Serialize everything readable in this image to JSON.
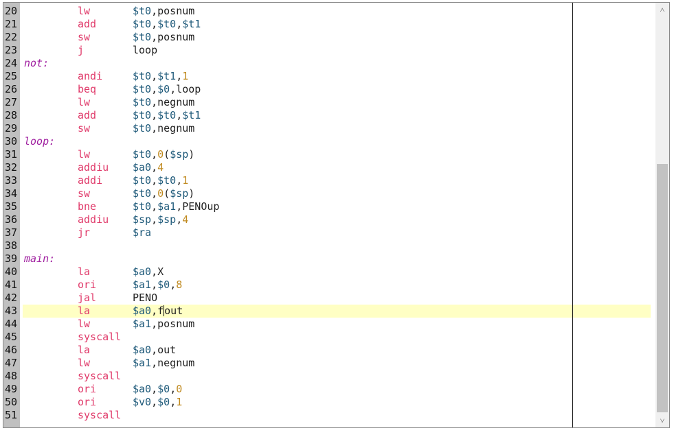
{
  "editor": {
    "current_line": 43,
    "cursor": {
      "line": 43,
      "column": 5
    },
    "scroll": {
      "thumb_start": 0.38,
      "thumb_end": 0.965
    },
    "icons": {
      "scroll_up": "chevron-up-icon",
      "scroll_down": "chevron-down-icon"
    },
    "colors": {
      "gutter": "#c0c0c0",
      "current_line": "#ffffc4",
      "label": "#a020a0",
      "instruction": "#e03a6a",
      "register": "#1f5a7a",
      "number": "#c08a20"
    },
    "lines": [
      {
        "n": "20",
        "label": "",
        "ins": "lw",
        "ops": [
          [
            "reg",
            "$t0"
          ],
          [
            "sym",
            ",posnum"
          ]
        ]
      },
      {
        "n": "21",
        "label": "",
        "ins": "add",
        "ops": [
          [
            "reg",
            "$t0"
          ],
          [
            "sym",
            ","
          ],
          [
            "reg",
            "$t0"
          ],
          [
            "sym",
            ","
          ],
          [
            "reg",
            "$t1"
          ]
        ]
      },
      {
        "n": "22",
        "label": "",
        "ins": "sw",
        "ops": [
          [
            "reg",
            "$t0"
          ],
          [
            "sym",
            ",posnum"
          ]
        ]
      },
      {
        "n": "23",
        "label": "",
        "ins": "j",
        "ops": [
          [
            "sym",
            "loop"
          ]
        ]
      },
      {
        "n": "24",
        "label": "not:",
        "ins": "",
        "ops": []
      },
      {
        "n": "25",
        "label": "",
        "ins": "andi",
        "ops": [
          [
            "reg",
            "$t0"
          ],
          [
            "sym",
            ","
          ],
          [
            "reg",
            "$t1"
          ],
          [
            "sym",
            ","
          ],
          [
            "num",
            "1"
          ]
        ]
      },
      {
        "n": "26",
        "label": "",
        "ins": "beq",
        "ops": [
          [
            "reg",
            "$t0"
          ],
          [
            "sym",
            ","
          ],
          [
            "reg",
            "$0"
          ],
          [
            "sym",
            ",loop"
          ]
        ]
      },
      {
        "n": "27",
        "label": "",
        "ins": "lw",
        "ops": [
          [
            "reg",
            "$t0"
          ],
          [
            "sym",
            ",negnum"
          ]
        ]
      },
      {
        "n": "28",
        "label": "",
        "ins": "add",
        "ops": [
          [
            "reg",
            "$t0"
          ],
          [
            "sym",
            ","
          ],
          [
            "reg",
            "$t0"
          ],
          [
            "sym",
            ","
          ],
          [
            "reg",
            "$t1"
          ]
        ]
      },
      {
        "n": "29",
        "label": "",
        "ins": "sw",
        "ops": [
          [
            "reg",
            "$t0"
          ],
          [
            "sym",
            ",negnum"
          ]
        ]
      },
      {
        "n": "30",
        "label": "loop:",
        "ins": "",
        "ops": []
      },
      {
        "n": "31",
        "label": "",
        "ins": "lw",
        "ops": [
          [
            "reg",
            "$t0"
          ],
          [
            "sym",
            ","
          ],
          [
            "num",
            "0"
          ],
          [
            "sym",
            "("
          ],
          [
            "reg",
            "$sp"
          ],
          [
            "sym",
            ")"
          ]
        ]
      },
      {
        "n": "32",
        "label": "",
        "ins": "addiu",
        "ops": [
          [
            "reg",
            "$a0"
          ],
          [
            "sym",
            ","
          ],
          [
            "num",
            "4"
          ]
        ]
      },
      {
        "n": "33",
        "label": "",
        "ins": "addi",
        "ops": [
          [
            "reg",
            "$t0"
          ],
          [
            "sym",
            ","
          ],
          [
            "reg",
            "$t0"
          ],
          [
            "sym",
            ","
          ],
          [
            "num",
            "1"
          ]
        ]
      },
      {
        "n": "34",
        "label": "",
        "ins": "sw",
        "ops": [
          [
            "reg",
            "$t0"
          ],
          [
            "sym",
            ","
          ],
          [
            "num",
            "0"
          ],
          [
            "sym",
            "("
          ],
          [
            "reg",
            "$sp"
          ],
          [
            "sym",
            ")"
          ]
        ]
      },
      {
        "n": "35",
        "label": "",
        "ins": "bne",
        "ops": [
          [
            "reg",
            "$t0"
          ],
          [
            "sym",
            ","
          ],
          [
            "reg",
            "$a1"
          ],
          [
            "sym",
            ",PENOup"
          ]
        ]
      },
      {
        "n": "36",
        "label": "",
        "ins": "addiu",
        "ops": [
          [
            "reg",
            "$sp"
          ],
          [
            "sym",
            ","
          ],
          [
            "reg",
            "$sp"
          ],
          [
            "sym",
            ","
          ],
          [
            "num",
            "4"
          ]
        ]
      },
      {
        "n": "37",
        "label": "",
        "ins": "jr",
        "ops": [
          [
            "reg",
            "$ra"
          ]
        ]
      },
      {
        "n": "38",
        "label": "",
        "ins": "",
        "ops": []
      },
      {
        "n": "39",
        "label": "main:",
        "ins": "",
        "ops": []
      },
      {
        "n": "40",
        "label": "",
        "ins": "la",
        "ops": [
          [
            "reg",
            "$a0"
          ],
          [
            "sym",
            ",X"
          ]
        ]
      },
      {
        "n": "41",
        "label": "",
        "ins": "ori",
        "ops": [
          [
            "reg",
            "$a1"
          ],
          [
            "sym",
            ","
          ],
          [
            "reg",
            "$0"
          ],
          [
            "sym",
            ","
          ],
          [
            "num",
            "8"
          ]
        ]
      },
      {
        "n": "42",
        "label": "",
        "ins": "jal",
        "ops": [
          [
            "sym",
            "PENO"
          ]
        ]
      },
      {
        "n": "43",
        "label": "",
        "ins": "la",
        "ops": [
          [
            "reg",
            "$a0"
          ],
          [
            "sym",
            ",f"
          ],
          [
            "cursor",
            ""
          ],
          [
            "sym",
            "out"
          ]
        ]
      },
      {
        "n": "44",
        "label": "",
        "ins": "lw",
        "ops": [
          [
            "reg",
            "$a1"
          ],
          [
            "sym",
            ",posnum"
          ]
        ]
      },
      {
        "n": "45",
        "label": "",
        "ins": "syscall",
        "ops": []
      },
      {
        "n": "46",
        "label": "",
        "ins": "la",
        "ops": [
          [
            "reg",
            "$a0"
          ],
          [
            "sym",
            ",out"
          ]
        ]
      },
      {
        "n": "47",
        "label": "",
        "ins": "lw",
        "ops": [
          [
            "reg",
            "$a1"
          ],
          [
            "sym",
            ",negnum"
          ]
        ]
      },
      {
        "n": "48",
        "label": "",
        "ins": "syscall",
        "ops": []
      },
      {
        "n": "49",
        "label": "",
        "ins": "ori",
        "ops": [
          [
            "reg",
            "$a0"
          ],
          [
            "sym",
            ","
          ],
          [
            "reg",
            "$0"
          ],
          [
            "sym",
            ","
          ],
          [
            "num",
            "0"
          ]
        ]
      },
      {
        "n": "50",
        "label": "",
        "ins": "ori",
        "ops": [
          [
            "reg",
            "$v0"
          ],
          [
            "sym",
            ","
          ],
          [
            "reg",
            "$0"
          ],
          [
            "sym",
            ","
          ],
          [
            "num",
            "1"
          ]
        ]
      },
      {
        "n": "51",
        "label": "",
        "ins": "syscall",
        "ops": []
      }
    ]
  }
}
